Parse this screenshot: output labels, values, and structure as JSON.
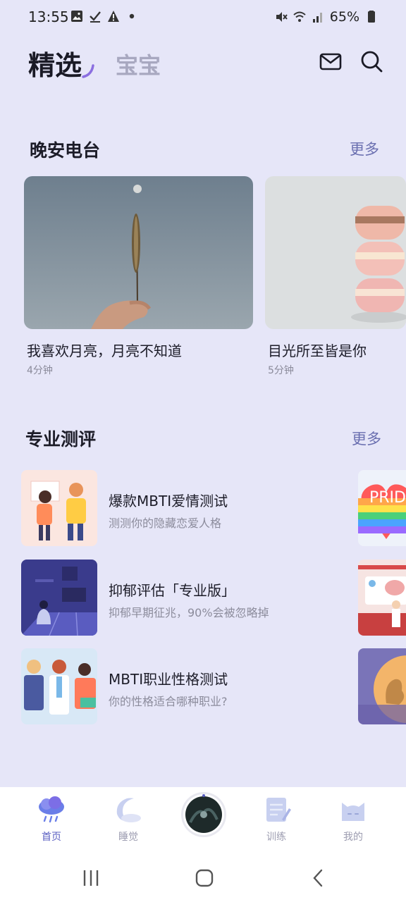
{
  "status_bar": {
    "time": "13:55",
    "battery_pct": "65%",
    "left_icons": [
      "gallery-icon",
      "check-icon",
      "warning-icon",
      "dot-icon"
    ],
    "right_icons": [
      "mute-icon",
      "wifi-icon",
      "signal-icon",
      "battery-icon"
    ]
  },
  "header": {
    "tabs": [
      {
        "label": "精选",
        "active": true
      },
      {
        "label": "宝宝",
        "active": false
      }
    ],
    "icons": [
      "mail-icon",
      "search-icon"
    ]
  },
  "radio_section": {
    "title": "晚安电台",
    "more": "更多",
    "items": [
      {
        "title": "我喜欢月亮，月亮不知道",
        "duration": "4分钟",
        "image": "wheat-in-hand-photo"
      },
      {
        "title": "目光所至皆是你",
        "duration": "5分钟",
        "image": "macarons-photo"
      }
    ]
  },
  "tests_section": {
    "title": "专业测评",
    "more": "更多",
    "items": [
      {
        "title": "爆款MBTI爱情测试",
        "subtitle": "测测你的隐藏恋爱人格"
      },
      {
        "title": "抑郁评估「专业版」",
        "subtitle": "抑郁早期征兆，90%会被忽略掉"
      },
      {
        "title": "MBTI职业性格测试",
        "subtitle": "你的性格适合哪种职业?"
      }
    ],
    "side_label": "PRIDE"
  },
  "bottom_nav": {
    "items": [
      {
        "label": "首页",
        "icon": "cloud-rain-icon",
        "active": true
      },
      {
        "label": "睡觉",
        "icon": "moon-icon",
        "active": false
      },
      {
        "label": "训练",
        "icon": "notepad-icon",
        "active": false
      },
      {
        "label": "我的",
        "icon": "cat-face-icon",
        "active": false
      }
    ]
  },
  "colors": {
    "background": "#e6e6f8",
    "accent": "#5a5fc2",
    "more_link": "#6a6fb0"
  }
}
